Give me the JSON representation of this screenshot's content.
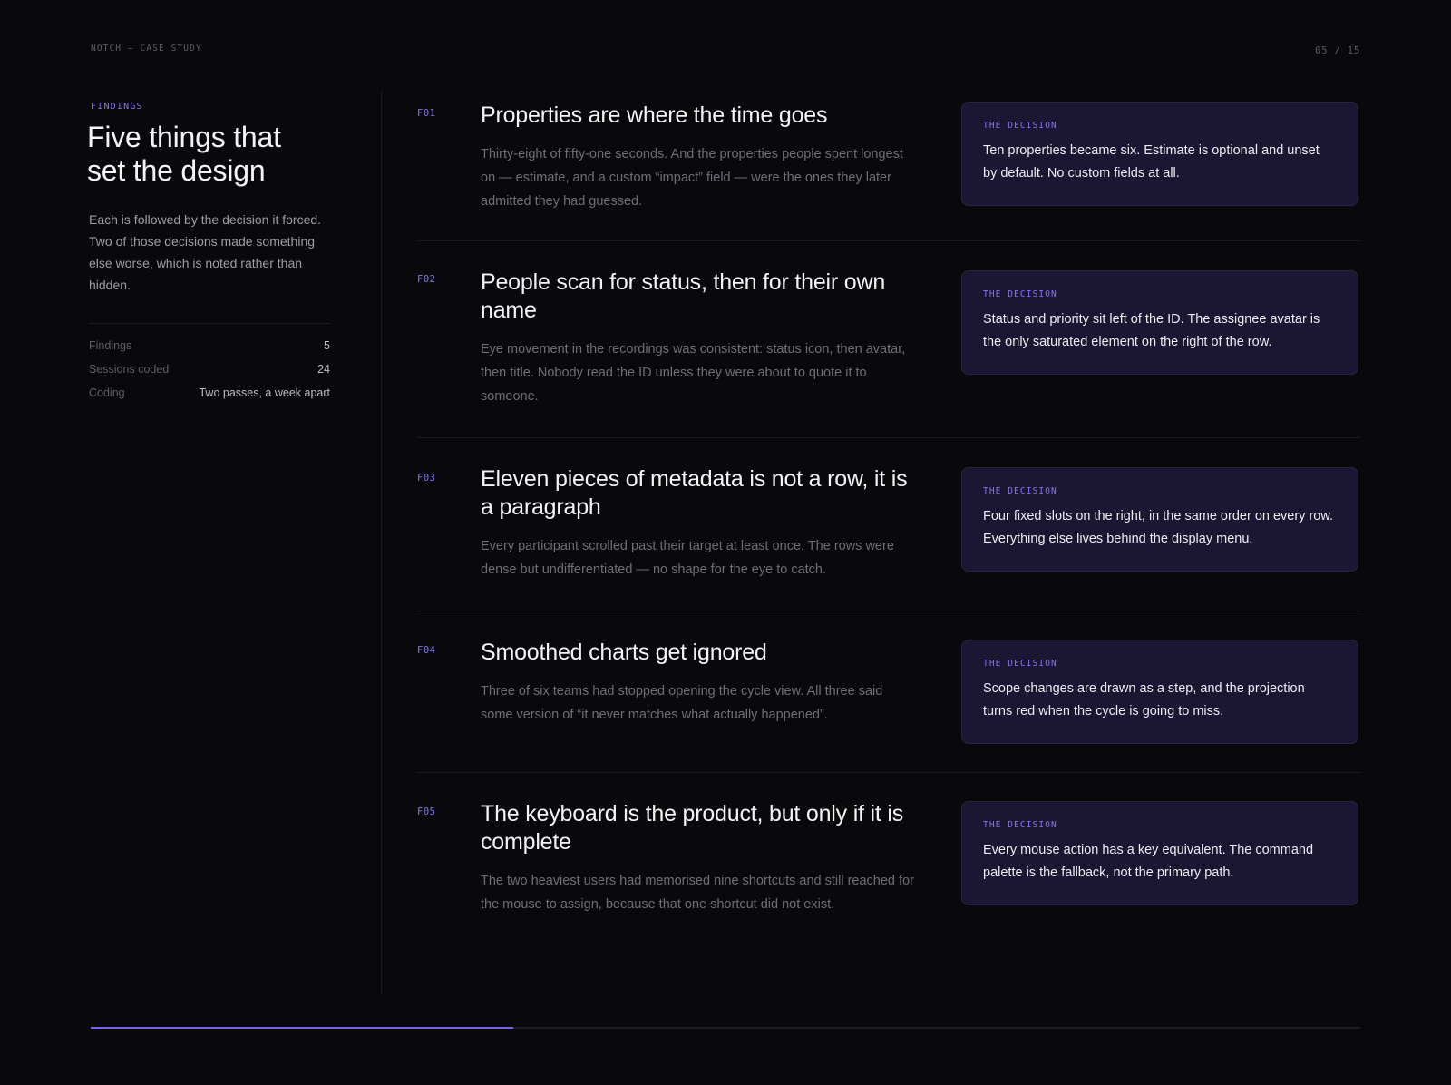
{
  "header": {
    "label": "NOTCH — CASE STUDY",
    "page": "05 / 15"
  },
  "left": {
    "eyebrow": "FINDINGS",
    "title_line1": "Five things that",
    "title_line2": "set the design",
    "description": "Each is followed by the decision it forced. Two of those decisions made something else worse, which is noted rather than hidden.",
    "stats": [
      {
        "label": "Findings",
        "value": "5"
      },
      {
        "label": "Sessions coded",
        "value": "24"
      },
      {
        "label": "Coding",
        "value": "Two passes, a week apart"
      }
    ]
  },
  "findings": [
    {
      "code": "F01",
      "title": "Properties are where the time goes",
      "text": "Thirty-eight of fifty-one seconds. And the properties people spent longest on — estimate, and a custom “impact” field — were the ones they later admitted they had guessed.",
      "decision_label": "THE DECISION",
      "decision": "Ten properties became six. Estimate is optional and unset by default. No custom fields at all."
    },
    {
      "code": "F02",
      "title": "People scan for status, then for their own name",
      "text": "Eye movement in the recordings was consistent: status icon, then avatar, then title. Nobody read the ID unless they were about to quote it to someone.",
      "decision_label": "THE DECISION",
      "decision": "Status and priority sit left of the ID. The assignee avatar is the only saturated element on the right of the row."
    },
    {
      "code": "F03",
      "title": "Eleven pieces of metadata is not a row, it is a paragraph",
      "text": "Every participant scrolled past their target at least once. The rows were dense but undifferentiated — no shape for the eye to catch.",
      "decision_label": "THE DECISION",
      "decision": "Four fixed slots on the right, in the same order on every row. Everything else lives behind the display menu."
    },
    {
      "code": "F04",
      "title": "Smoothed charts get ignored",
      "text": "Three of six teams had stopped opening the cycle view. All three said some version of “it never matches what actually happened”.",
      "decision_label": "THE DECISION",
      "decision": "Scope changes are drawn as a step, and the projection turns red when the cycle is going to miss."
    },
    {
      "code": "F05",
      "title": "The keyboard is the product, but only if it is complete",
      "text": "The two heaviest users had memorised nine shortcuts and still reached for the mouse to assign, because that one shortcut did not exist.",
      "decision_label": "THE DECISION",
      "decision": "Every mouse action has a key equivalent. The command palette is the fallback, not the primary path."
    }
  ],
  "progress": {
    "fraction": 0.333
  },
  "colors": {
    "accent": "#8b72f0",
    "background": "#09090b",
    "card": "#1b1631"
  }
}
